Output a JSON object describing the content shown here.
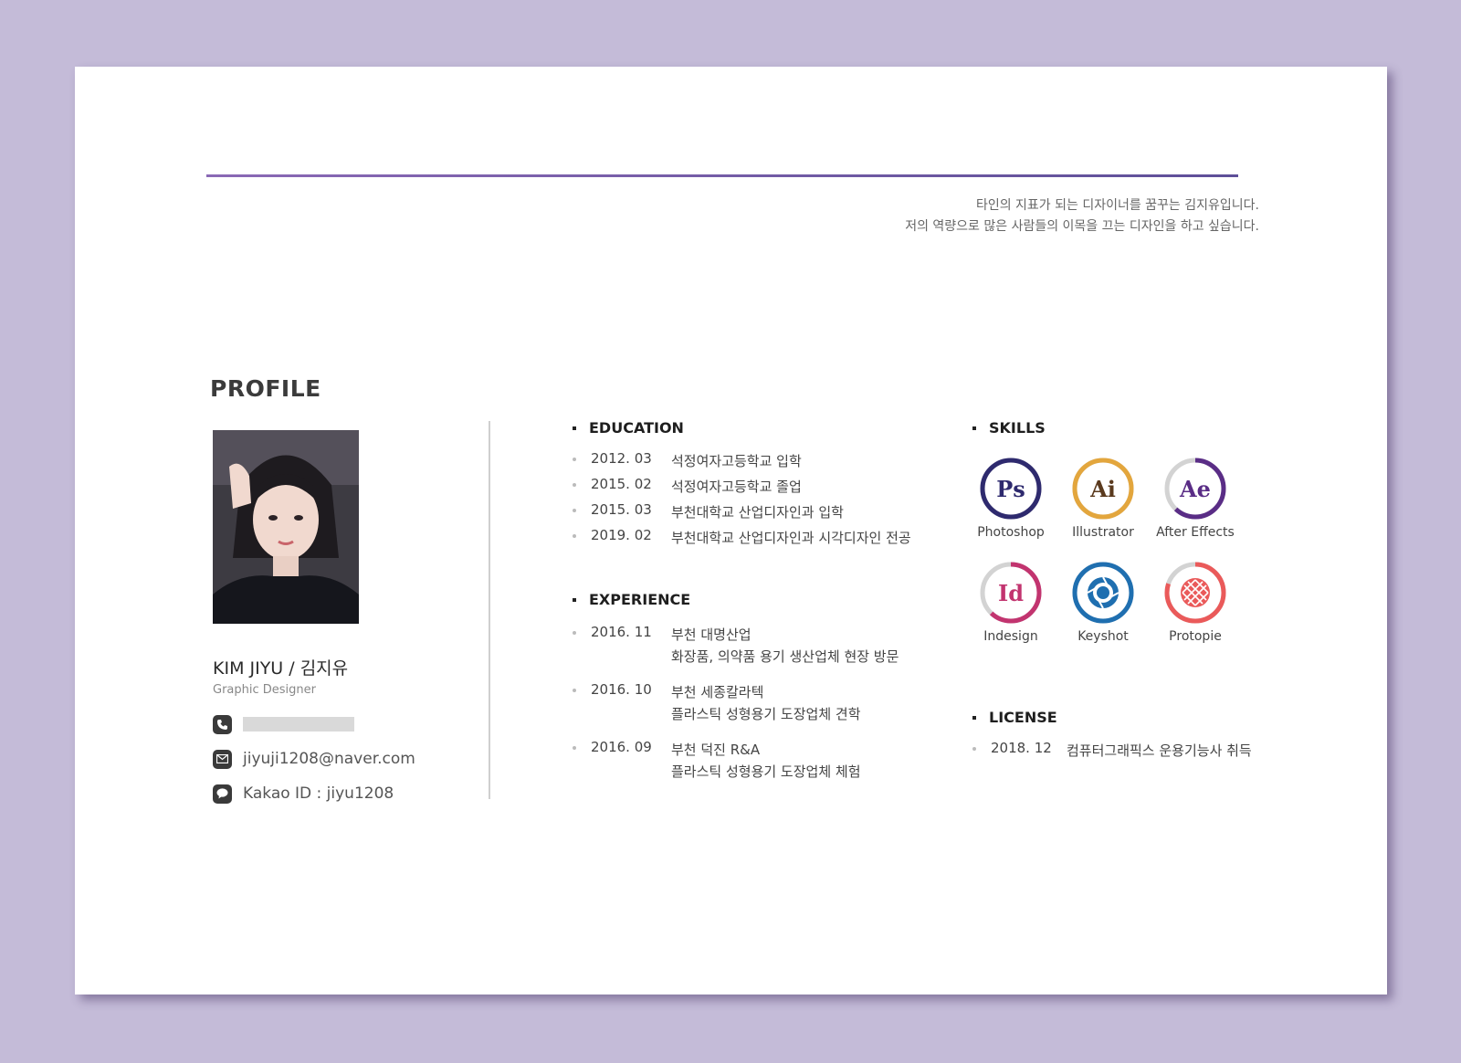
{
  "intro": {
    "line1": "타인의 지표가 되는 디자이너를 꿈꾸는 김지유입니다.",
    "line2": "저의 역량으로 많은 사람들의 이목을 끄는 디자인을 하고 싶습니다."
  },
  "profile": {
    "heading": "PROFILE",
    "name": "KIM JIYU / 김지유",
    "role": "Graphic Designer",
    "contacts": [
      {
        "icon": "phone-icon",
        "value": ""
      },
      {
        "icon": "mail-icon",
        "value": "jiyuji1208@naver.com"
      },
      {
        "icon": "chat-icon",
        "value": "Kakao ID : jiyu1208"
      }
    ]
  },
  "education": {
    "title": "EDUCATION",
    "items": [
      {
        "date": "2012. 03",
        "text": "석정여자고등학교 입학"
      },
      {
        "date": "2015. 02",
        "text": "석정여자고등학교 졸업"
      },
      {
        "date": "2015. 03",
        "text": "부천대학교 산업디자인과 입학"
      },
      {
        "date": "2019. 02",
        "text": "부천대학교 산업디자인과 시각디자인 전공"
      }
    ]
  },
  "experience": {
    "title": "EXPERIENCE",
    "items": [
      {
        "date": "2016. 11",
        "company": "부천 대명산업",
        "detail": "화장품, 의약품 용기 생산업체 현장 방문"
      },
      {
        "date": "2016. 10",
        "company": "부천 세종칼라텍",
        "detail": "플라스틱 성형용기 도장업체 견학"
      },
      {
        "date": "2016. 09",
        "company": "부천 덕진 R&A",
        "detail": "플라스틱 성형용기 도장업체 체험"
      }
    ]
  },
  "skills": {
    "title": "SKILLS",
    "items": [
      {
        "name": "Photoshop",
        "abbr": "Ps",
        "color": "#2e2a6e",
        "level": 1.0
      },
      {
        "name": "Illustrator",
        "abbr": "Ai",
        "color": "#e3a63d",
        "level": 1.0
      },
      {
        "name": "After Effects",
        "abbr": "Ae",
        "color": "#5a2d86",
        "level": 0.62
      },
      {
        "name": "Indesign",
        "abbr": "Id",
        "color": "#c2346f",
        "level": 0.62
      },
      {
        "name": "Keyshot",
        "abbr": "",
        "color": "#1f6fb0",
        "level": 1.0
      },
      {
        "name": "Protopie",
        "abbr": "",
        "color": "#ea5a5a",
        "level": 0.8
      }
    ]
  },
  "license": {
    "title": "LICENSE",
    "items": [
      {
        "date": "2018. 12",
        "text": "컴퓨터그래픽스 운용기능사 취득"
      }
    ]
  },
  "colors": {
    "background": "#c4bbd8",
    "accent": "#7a63ad"
  }
}
